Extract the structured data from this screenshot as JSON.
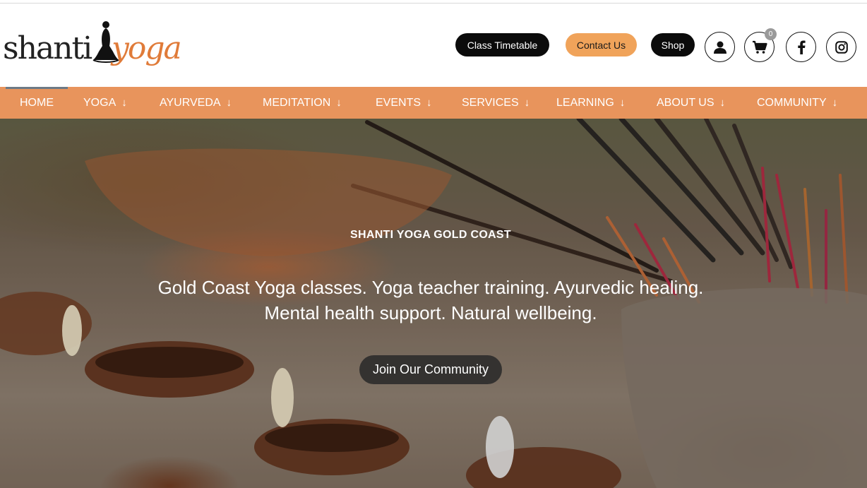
{
  "logo": {
    "text_left": "shanti",
    "text_right": "yoga"
  },
  "header": {
    "timetable_label": "Class Timetable",
    "contact_label": "Contact Us",
    "shop_label": "Shop",
    "cart_count": "0"
  },
  "nav": {
    "items": [
      {
        "label": "HOME"
      },
      {
        "label": "YOGA",
        "arrow": "↓"
      },
      {
        "label": "AYURVEDA",
        "arrow": "↓"
      },
      {
        "label": "MEDITATION",
        "arrow": "↓"
      },
      {
        "label": "EVENTS",
        "arrow": "↓"
      },
      {
        "label": "SERVICES",
        "arrow": "↓"
      },
      {
        "label": "LEARNING",
        "arrow": "↓"
      },
      {
        "label": "ABOUT US",
        "arrow": "↓"
      },
      {
        "label": "COMMUNITY",
        "arrow": "↓"
      }
    ]
  },
  "hero": {
    "eyebrow": "SHANTI YOGA GOLD COAST",
    "line1": "Gold Coast Yoga classes. Yoga teacher training. Ayurvedic healing.",
    "line2": "Mental health support. Natural wellbeing.",
    "cta_label": "Join Our Community"
  },
  "colors": {
    "nav_bg": "#e8945c",
    "accent_orange": "#f0a35a",
    "dark_pill": "#0b0b0b"
  }
}
